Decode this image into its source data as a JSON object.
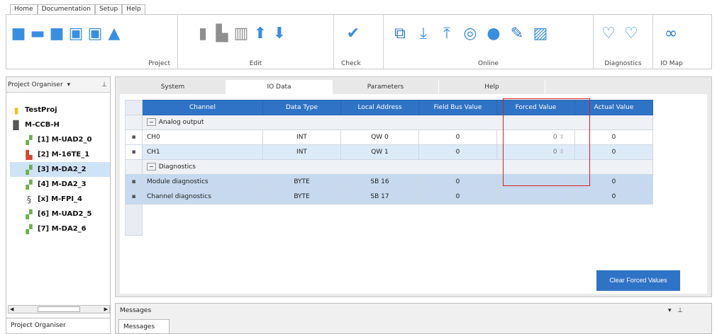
{
  "menu": {
    "items": [
      "Home",
      "Documentation",
      "Setup",
      "Help"
    ]
  },
  "ribbon": {
    "groups": [
      {
        "label": "Project",
        "icons": [
          "open-folder-icon",
          "folder-icon",
          "project-folder-icon",
          "save-icon",
          "save-as-icon",
          "lock-icon"
        ]
      },
      {
        "label": "Edit",
        "icons": [
          "copy-icon",
          "paste-icon",
          "delete-icon",
          "arrow-up-icon",
          "arrow-down-icon"
        ]
      },
      {
        "label": "Check",
        "icons": [
          "check-icon"
        ]
      },
      {
        "label": "Online",
        "icons": [
          "connect-icon",
          "download-icon",
          "upload-icon",
          "settings-circle-icon",
          "info-icon",
          "wrench-icon",
          "edit-icon"
        ]
      },
      {
        "label": "Diagnostics",
        "icons": [
          "diagnostics-icon",
          "diagnostics-2-icon"
        ]
      },
      {
        "label": "IO Map",
        "icons": [
          "link-icon"
        ]
      }
    ]
  },
  "project_organiser": {
    "title": "Project Organiser",
    "footer": "Project Organiser",
    "items": [
      {
        "label": "TestProj",
        "icon": "project-icon",
        "level": 0
      },
      {
        "label": "M-CCB-H",
        "icon": "controller-icon",
        "level": 0
      },
      {
        "label": "[1] M-UAD2_0",
        "icon": "module-green-icon",
        "level": 1
      },
      {
        "label": "[2] M-16TE_1",
        "icon": "module-red-icon",
        "level": 1
      },
      {
        "label": "[3] M-DA2_2",
        "icon": "module-green-icon",
        "level": 1,
        "selected": true
      },
      {
        "label": "[4] M-DA2_3",
        "icon": "module-green-icon",
        "level": 1
      },
      {
        "label": "[x] M-FPI_4",
        "icon": "module-s-icon",
        "level": 1
      },
      {
        "label": "[6] M-UAD2_5",
        "icon": "module-green-icon",
        "level": 1
      },
      {
        "label": "[7] M-DA2_6",
        "icon": "module-green-icon",
        "level": 1
      }
    ]
  },
  "tabs": [
    "System",
    "IO Data",
    "Parameters",
    "Help"
  ],
  "table": {
    "headers": [
      "Channel",
      "Data Type",
      "Local Address",
      "Field Bus Value",
      "Forced Value",
      "Actual Value"
    ],
    "groups": [
      {
        "name": "Analog output",
        "rows": [
          {
            "channel": "CH0",
            "type": "INT",
            "address": "QW 0",
            "fieldbus": "0",
            "forced": "0",
            "actual": "0"
          },
          {
            "channel": "CH1",
            "type": "INT",
            "address": "QW 1",
            "fieldbus": "0",
            "forced": "0",
            "actual": "0"
          }
        ]
      },
      {
        "name": "Diagnostics",
        "rows": [
          {
            "channel": "Module diagnostics",
            "type": "BYTE",
            "address": "SB 16",
            "fieldbus": "0",
            "forced": "",
            "actual": "0"
          },
          {
            "channel": "Channel diagnostics",
            "type": "BYTE",
            "address": "SB 17",
            "fieldbus": "0",
            "forced": "",
            "actual": "0"
          }
        ]
      }
    ]
  },
  "buttons": {
    "clear_forced": "Clear Forced Values"
  },
  "messages": {
    "title": "Messages",
    "tab": "Messages"
  },
  "colors": {
    "accent": "#2f73c6",
    "highlight_box": "#d62020",
    "selected_row": "#c6d9ee"
  }
}
